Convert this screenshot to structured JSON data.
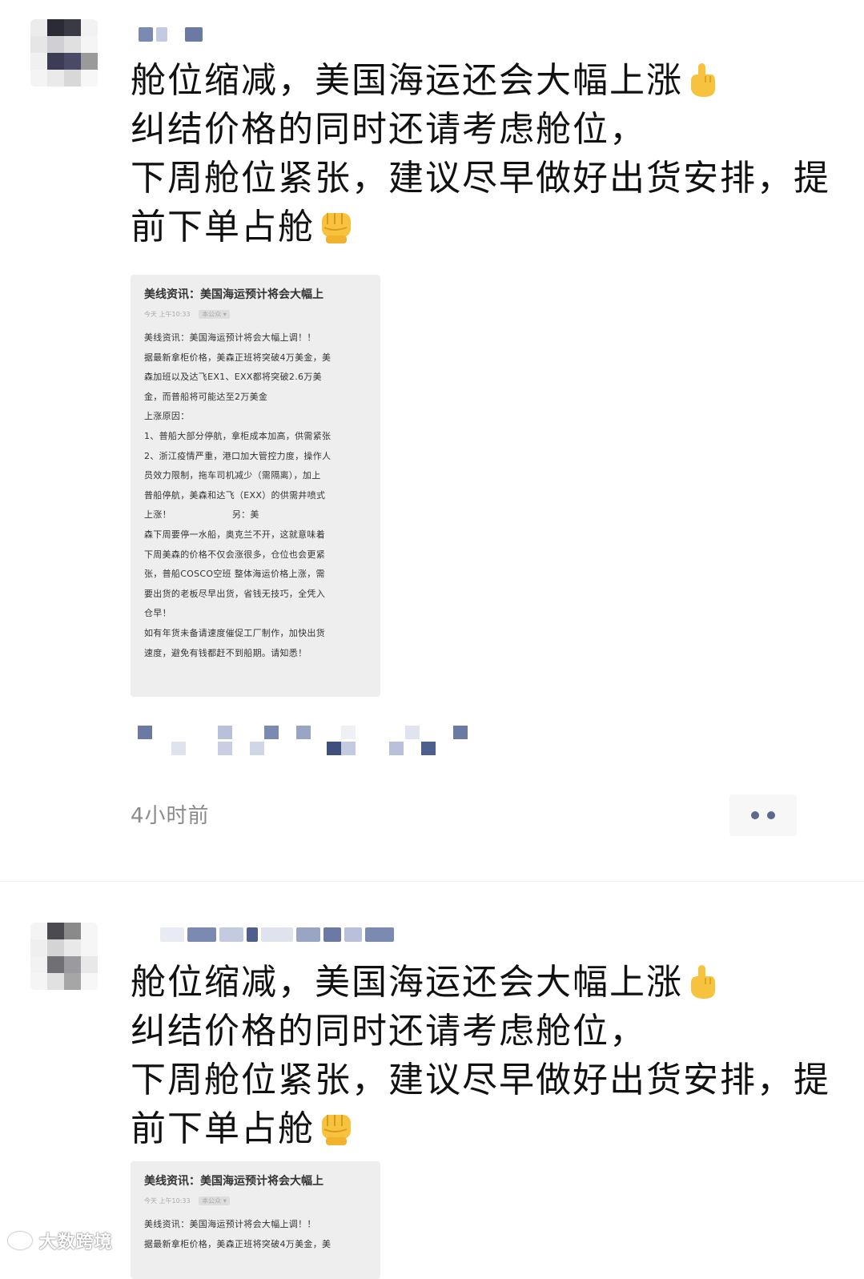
{
  "feed": {
    "posts": [
      {
        "lines": [
          "舱位缩减，美国海运还会大幅上涨",
          "纠结价格的同时还请考虑舱位，",
          "下周舱位紧张，建议尽早做好出货安排，提",
          "前下单占舱"
        ],
        "card": {
          "title": "美线资讯：美国海运预计将会大幅上",
          "meta_time": "今天 上午10:33",
          "meta_tag": "本公众 ▾",
          "body": [
            "美线资讯：美国海运预计将会大幅上调！！",
            "据最新拿柜价格，美森正班将突破4万美金，美",
            "森加班以及达飞EX1、EXX都将突破2.6万美",
            "金，而普船将可能达至2万美金",
            "上涨原因：",
            "1、普船大部分停航，拿柜成本加高，供需紧张",
            "2、浙江疫情严重，港口加大管控力度，操作人",
            "员效力限制，拖车司机减少（需隔离），加上",
            "普船停航，美森和达飞（EXX）的供需井喷式",
            "上涨！                    另：美",
            "森下周要停一水船，奥克兰不开，这就意味着",
            "下周美森的价格不仅会涨很多，仓位也会更紧",
            "张，普船COSCO空班 整体海运价格上涨，需",
            "要出货的老板尽早出货，省钱无技巧，全凭入",
            "仓早！",
            "如有年货未备请速度催促工厂制作，加快出货",
            "速度，避免有钱都赶不到船期。请知悉！"
          ]
        },
        "time": "4小时前"
      },
      {
        "lines": [
          "舱位缩减，美国海运还会大幅上涨",
          "纠结价格的同时还请考虑舱位，",
          "下周舱位紧张，建议尽早做好出货安排，提",
          "前下单占舱"
        ],
        "card": {
          "title": "美线资讯：美国海运预计将会大幅上",
          "meta_time": "今天 上午10:33",
          "meta_tag": "本公众 ▾",
          "body": [
            "美线资讯：美国海运预计将会大幅上调！！",
            "据最新拿柜价格，美森正班将突破4万美金，美"
          ]
        }
      }
    ]
  },
  "icons": {
    "pointing_down": "backhand-index-pointing-down-icon",
    "raised_fist": "raised-fist-icon",
    "more": "more-options-icon"
  },
  "colors": {
    "emoji_skin": "#f7c23d",
    "more_dots": "#5a6a8c",
    "time": "#8a8a8a",
    "card_bg": "#eeeeee"
  },
  "watermark": "大数跨境"
}
